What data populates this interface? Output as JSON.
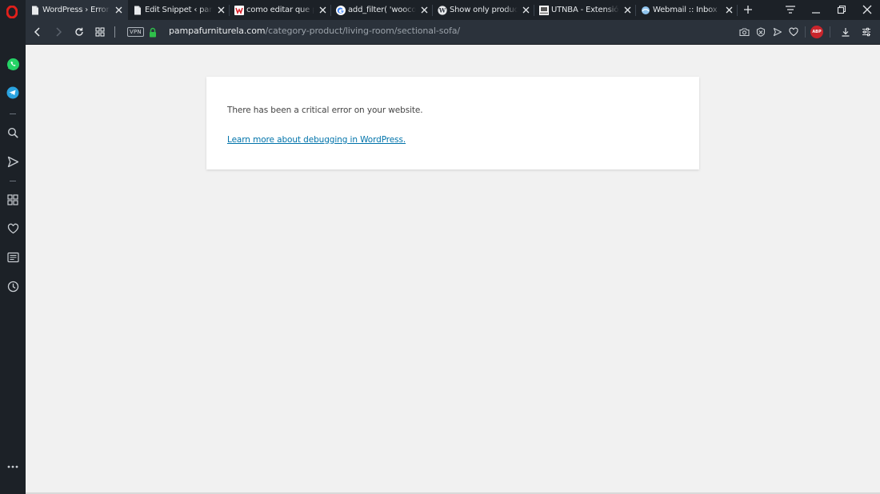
{
  "browser": {
    "tabs": [
      {
        "title": "WordPress › Error",
        "favicon": "page-icon",
        "active": true
      },
      {
        "title": "Edit Snippet ‹ pamp",
        "favicon": "page-icon",
        "active": false
      },
      {
        "title": "como editar que pr",
        "favicon": "wallapop-icon",
        "active": false
      },
      {
        "title": "add_filter( 'woocom",
        "favicon": "google-icon",
        "active": false
      },
      {
        "title": "Show only product",
        "favicon": "wordpress-icon",
        "active": false
      },
      {
        "title": "UTNBA - Extensión",
        "favicon": "utnba-icon",
        "active": false
      },
      {
        "title": "Webmail :: Inbox :: /",
        "favicon": "webmail-icon",
        "active": false
      }
    ],
    "address": {
      "vpn_label": "VPN",
      "url_host": "pampafurniturela.com",
      "url_path": "/category-product/living-room/sectional-sofa/"
    },
    "abp_label": "ABP",
    "colors": {
      "chrome_dark": "#1c2127",
      "tab_active": "#2b323b",
      "opera_red": "#e0201b",
      "whatsapp_green": "#25d366",
      "telegram_blue": "#2aa3e0",
      "link_blue": "#0073aa",
      "abp_red": "#c9252c"
    }
  },
  "sidebar": {
    "items": [
      "whatsapp-icon",
      "telegram-icon",
      "search-icon",
      "send-icon",
      "speed-dial-icon",
      "heart-icon",
      "news-icon",
      "history-icon",
      "more-icon"
    ]
  },
  "page": {
    "error_message": "There has been a critical error on your website.",
    "debug_link": "Learn more about debugging in WordPress."
  }
}
